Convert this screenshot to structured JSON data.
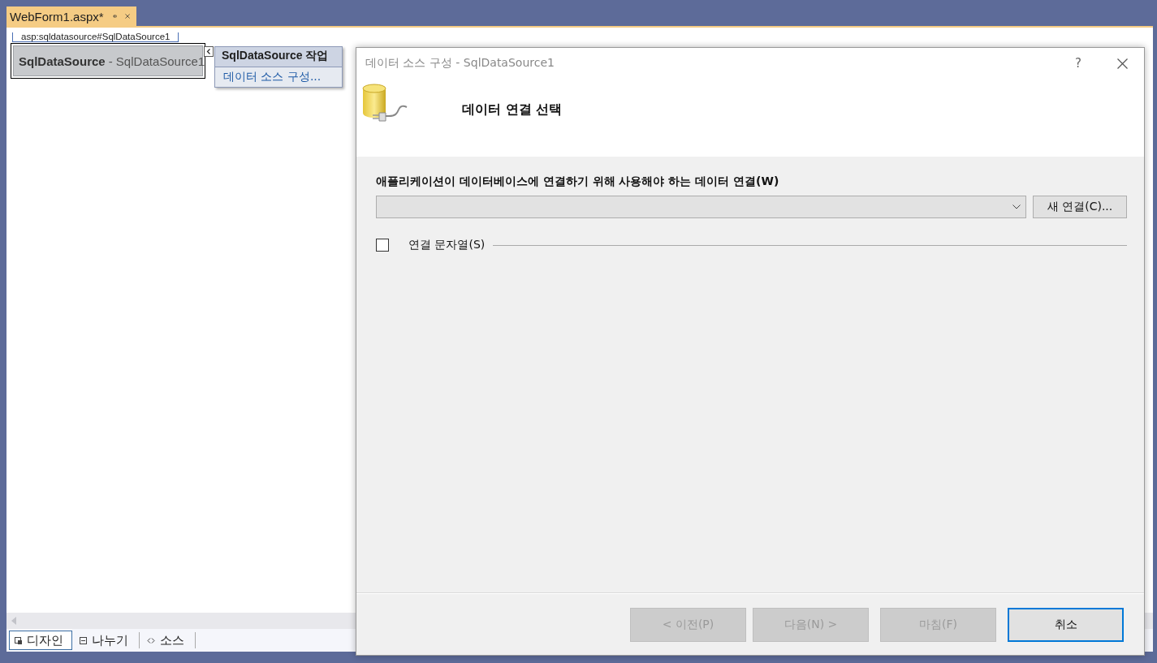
{
  "document_tab": {
    "title": "WebForm1.aspx*"
  },
  "designer": {
    "element_tag": "asp:sqldatasource#SqlDataSource1",
    "control_type": "SqlDataSource",
    "control_separator": "-",
    "control_id": "SqlDataSource1"
  },
  "smart_tag": {
    "title": "SqlDataSource 작업",
    "items": [
      "데이터 소스 구성..."
    ]
  },
  "view_tabs": [
    {
      "label": "디자인",
      "kind": "design",
      "selected": true
    },
    {
      "label": "나누기",
      "kind": "split",
      "selected": false
    },
    {
      "label": "소스",
      "kind": "source",
      "selected": false
    }
  ],
  "dialog": {
    "title": "데이터 소스 구성 - SqlDataSource1",
    "help": "?",
    "heading": "데이터 연결 선택",
    "connection_label": "애플리케이션이 데이터베이스에 연결하기 위해 사용해야 하는 데이터 연결(W)",
    "new_connection_button": "새 연결(C)...",
    "connection_string": {
      "label": "연결 문자열(S)",
      "checked": false
    },
    "buttons": [
      {
        "label": "< 이전(P)",
        "disabled": true,
        "focused": false
      },
      {
        "label": "다음(N) >",
        "disabled": true,
        "focused": false
      },
      {
        "label": "마침(F)",
        "disabled": true,
        "focused": false
      },
      {
        "label": "취소",
        "disabled": false,
        "focused": true
      }
    ]
  }
}
